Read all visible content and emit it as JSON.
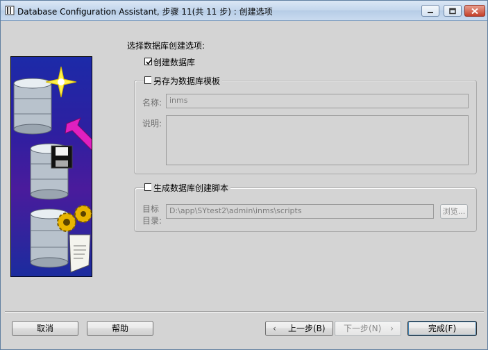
{
  "window": {
    "title": "Database Configuration Assistant, 步骤 11(共 11 步) : 创建选项"
  },
  "main": {
    "section_title": "选择数据库创建选项:",
    "create_db": {
      "label": "创建数据库",
      "checked": true
    },
    "save_template": {
      "label": "另存为数据库模板",
      "checked": false,
      "name_label": "名称:",
      "name_value": "inms",
      "desc_label": "说明:",
      "desc_value": ""
    },
    "gen_script": {
      "label": "生成数据库创建脚本",
      "checked": false,
      "dir_label_line1": "目标",
      "dir_label_line2": "目录:",
      "dir_value": "D:\\app\\SYtest2\\admin\\inms\\scripts",
      "browse_label": "浏览..."
    }
  },
  "footer": {
    "cancel_label": "取消",
    "help_label": "帮助",
    "back_label": "上一步(B)",
    "next_label": "下一步(N)",
    "finish_label": "完成(F)"
  },
  "colors": {
    "banner_top": "#1c2aa8",
    "banner_mid": "#4a1b9c",
    "arrow": "#e020c0",
    "star": "#fff14a"
  },
  "icons": [
    "app-icon",
    "minimize-icon",
    "maximize-icon",
    "close-icon",
    "database-icon",
    "floppy-disk-icon",
    "gear-icon",
    "sql-script-icon",
    "star-icon",
    "arrow-icon",
    "chevron-left-icon",
    "chevron-right-icon",
    "checkmark-icon"
  ]
}
